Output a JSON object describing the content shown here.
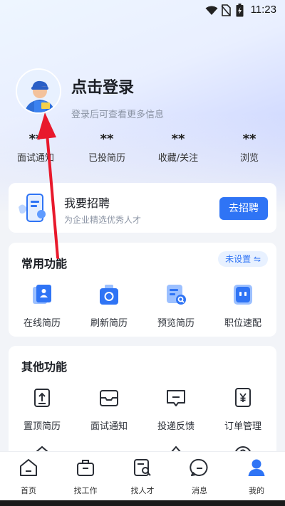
{
  "status_bar": {
    "time": "11:23"
  },
  "profile": {
    "login_title": "点击登录",
    "login_subtitle": "登录后可查看更多信息",
    "stats": [
      {
        "value": "**",
        "label": "面试通知"
      },
      {
        "value": "**",
        "label": "已投简历"
      },
      {
        "value": "**",
        "label": "收藏/关注"
      },
      {
        "value": "**",
        "label": "浏览"
      }
    ]
  },
  "recruit_card": {
    "title": "我要招聘",
    "subtitle": "为企业精选优秀人才",
    "button": "去招聘"
  },
  "common_functions": {
    "title": "常用功能",
    "badge": "未设置 ⇋",
    "items": [
      {
        "label": "在线简历",
        "icon": "resume-icon"
      },
      {
        "label": "刷新简历",
        "icon": "refresh-icon"
      },
      {
        "label": "预览简历",
        "icon": "preview-icon"
      },
      {
        "label": "职位速配",
        "icon": "match-icon"
      }
    ]
  },
  "other_functions": {
    "title": "其他功能",
    "items": [
      {
        "label": "置顶简历",
        "icon": "pin-top-icon"
      },
      {
        "label": "面试通知",
        "icon": "mail-icon"
      },
      {
        "label": "投递反馈",
        "icon": "feedback-icon"
      },
      {
        "label": "订单管理",
        "icon": "order-icon"
      }
    ]
  },
  "tab_bar": {
    "items": [
      {
        "label": "首页",
        "icon": "home-icon"
      },
      {
        "label": "找工作",
        "icon": "briefcase-icon"
      },
      {
        "label": "找人才",
        "icon": "talent-search-icon"
      },
      {
        "label": "消息",
        "icon": "message-icon"
      },
      {
        "label": "我的",
        "icon": "user-icon",
        "active": true
      }
    ]
  },
  "colors": {
    "accent": "#2f74f5",
    "annotation_arrow": "#e8192c"
  }
}
